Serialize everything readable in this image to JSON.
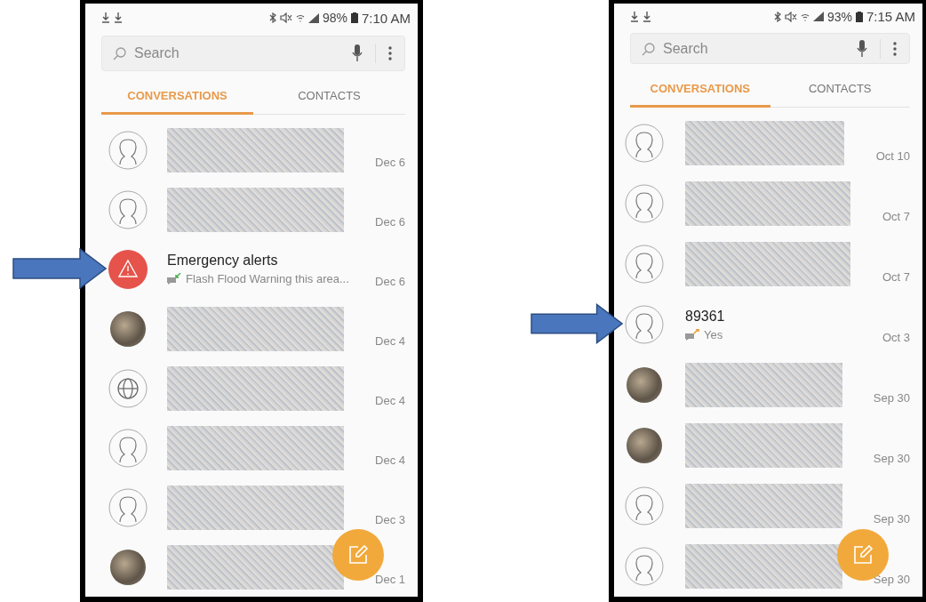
{
  "phones": [
    {
      "status": {
        "battery": "98%",
        "time": "7:10 AM"
      },
      "search": {
        "placeholder": "Search"
      },
      "tabs": [
        {
          "label": "CONVERSATIONS",
          "selected": true
        },
        {
          "label": "CONTACTS",
          "selected": false
        }
      ],
      "rows": [
        {
          "kind": "redacted",
          "avatar": {
            "kind": "person"
          },
          "date": "Dec 6",
          "pointed": false
        },
        {
          "kind": "redacted",
          "avatar": {
            "kind": "person"
          },
          "date": "Dec 6",
          "pointed": false
        },
        {
          "kind": "message",
          "avatar": {
            "kind": "alert"
          },
          "title": "Emergency alerts",
          "preview": "Flash Flood Warning this area...",
          "sent": false,
          "date": "Dec 6",
          "pointed": true
        },
        {
          "kind": "redacted",
          "avatar": {
            "kind": "photo"
          },
          "date": "Dec 4",
          "pointed": false
        },
        {
          "kind": "redacted",
          "avatar": {
            "kind": "globe"
          },
          "date": "Dec 4",
          "pointed": false
        },
        {
          "kind": "redacted",
          "avatar": {
            "kind": "person"
          },
          "date": "Dec 4",
          "pointed": false
        },
        {
          "kind": "redacted",
          "avatar": {
            "kind": "person"
          },
          "date": "Dec 3",
          "pointed": false
        },
        {
          "kind": "redacted",
          "avatar": {
            "kind": "photo"
          },
          "date": "Dec 1",
          "pointed": false
        }
      ]
    },
    {
      "status": {
        "battery": "93%",
        "time": "7:15 AM"
      },
      "search": {
        "placeholder": "Search"
      },
      "tabs": [
        {
          "label": "CONVERSATIONS",
          "selected": true
        },
        {
          "label": "CONTACTS",
          "selected": false
        }
      ],
      "rows": [
        {
          "kind": "redacted",
          "avatar": {
            "kind": "person"
          },
          "date": "Oct 10",
          "pointed": false
        },
        {
          "kind": "redacted",
          "avatar": {
            "kind": "person"
          },
          "date": "Oct 7",
          "pointed": false
        },
        {
          "kind": "redacted",
          "avatar": {
            "kind": "person"
          },
          "date": "Oct 7",
          "pointed": false
        },
        {
          "kind": "message",
          "avatar": {
            "kind": "person"
          },
          "title": "89361",
          "preview": "Yes",
          "sent": true,
          "date": "Oct 3",
          "pointed": true
        },
        {
          "kind": "redacted",
          "avatar": {
            "kind": "photo"
          },
          "date": "Sep 30",
          "pointed": false
        },
        {
          "kind": "redacted",
          "avatar": {
            "kind": "photo"
          },
          "date": "Sep 30",
          "pointed": false
        },
        {
          "kind": "redacted",
          "avatar": {
            "kind": "person"
          },
          "date": "Sep 30",
          "pointed": false
        },
        {
          "kind": "redacted",
          "avatar": {
            "kind": "person"
          },
          "date": "Sep 30",
          "pointed": false
        }
      ]
    }
  ]
}
